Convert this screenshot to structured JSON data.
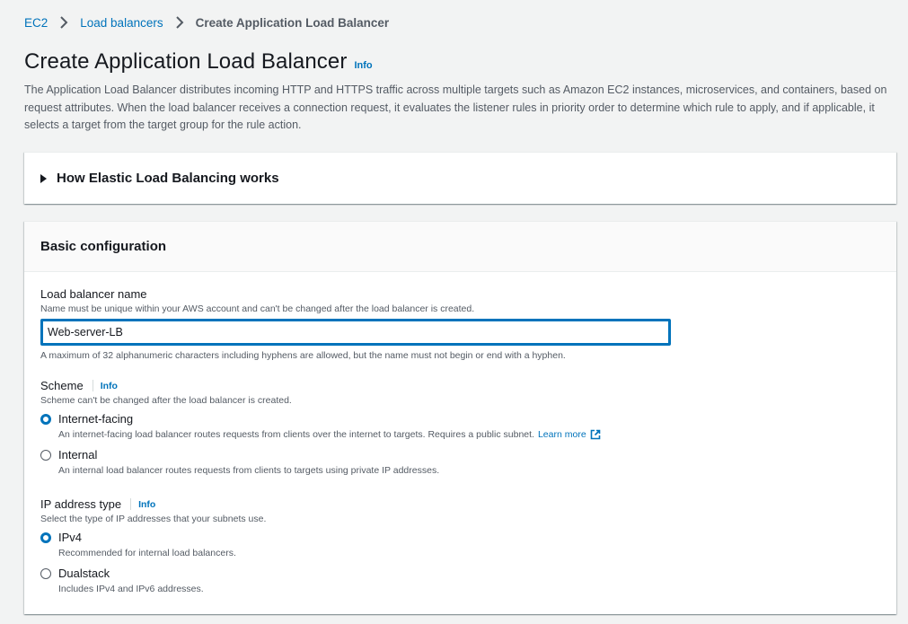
{
  "breadcrumb": {
    "items": [
      "EC2",
      "Load balancers"
    ],
    "current": "Create Application Load Balancer"
  },
  "header": {
    "title": "Create Application Load Balancer",
    "info": "Info",
    "description": "The Application Load Balancer distributes incoming HTTP and HTTPS traffic across multiple targets such as Amazon EC2 instances, microservices, and containers, based on request attributes. When the load balancer receives a connection request, it evaluates the listener rules in priority order to determine which rule to apply, and if applicable, it selects a target from the target group for the rule action."
  },
  "how_it_works": {
    "title": "How Elastic Load Balancing works"
  },
  "basic_config": {
    "title": "Basic configuration",
    "lb_name": {
      "label": "Load balancer name",
      "description": "Name must be unique within your AWS account and can't be changed after the load balancer is created.",
      "value": "Web-server-LB",
      "constraint": "A maximum of 32 alphanumeric characters including hyphens are allowed, but the name must not begin or end with a hyphen."
    },
    "scheme": {
      "label": "Scheme",
      "info": "Info",
      "description": "Scheme can't be changed after the load balancer is created.",
      "options": [
        {
          "label": "Internet-facing",
          "description": "An internet-facing load balancer routes requests from clients over the internet to targets. Requires a public subnet.",
          "link": "Learn more",
          "selected": true
        },
        {
          "label": "Internal",
          "description": "An internal load balancer routes requests from clients to targets using private IP addresses.",
          "selected": false
        }
      ]
    },
    "ip_type": {
      "label": "IP address type",
      "info": "Info",
      "description": "Select the type of IP addresses that your subnets use.",
      "options": [
        {
          "label": "IPv4",
          "description": "Recommended for internal load balancers.",
          "selected": true
        },
        {
          "label": "Dualstack",
          "description": "Includes IPv4 and IPv6 addresses.",
          "selected": false
        }
      ]
    }
  },
  "colors": {
    "link": "#0073bb",
    "background": "#f2f3f3",
    "text": "#16191f",
    "secondary_text": "#545b64"
  }
}
